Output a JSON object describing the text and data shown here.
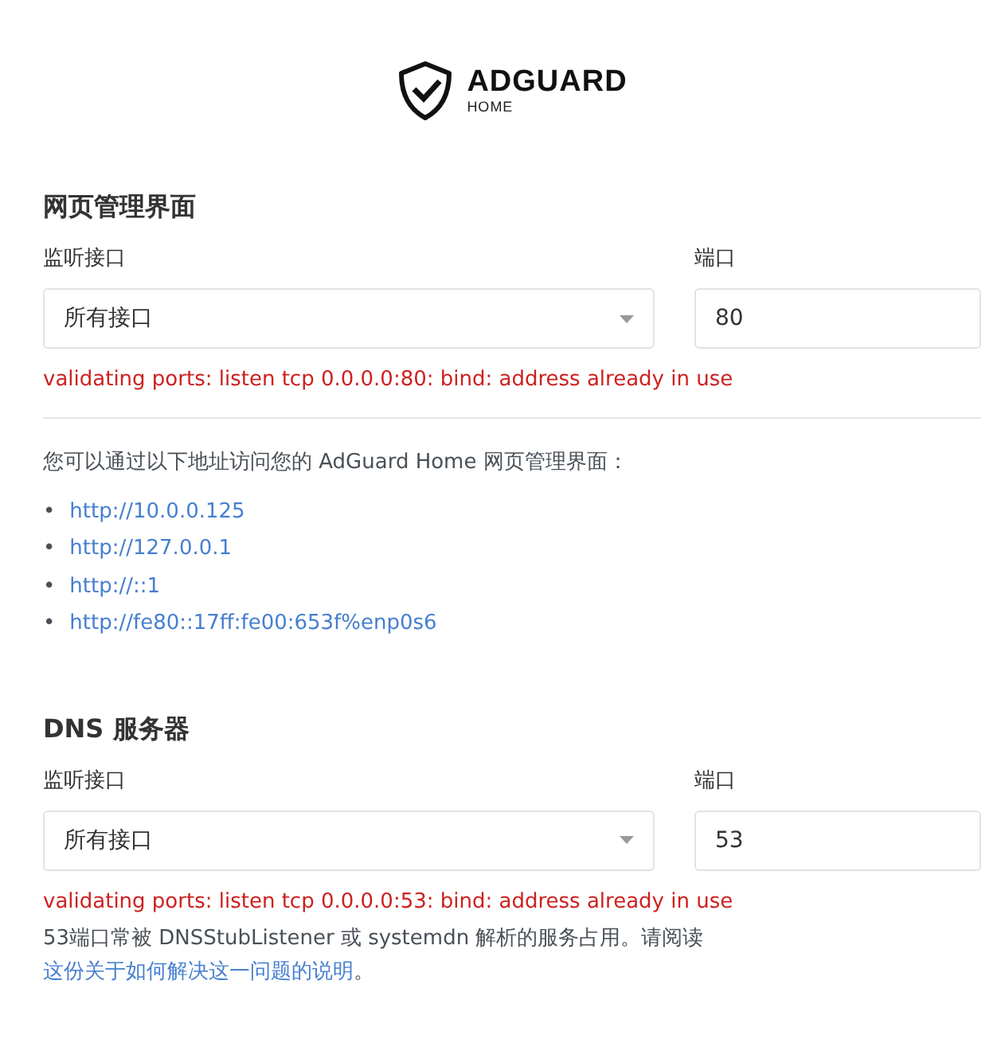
{
  "logo": {
    "title": "ADGUARD",
    "subtitle": "HOME"
  },
  "sections": [
    {
      "title": "网页管理界面",
      "interface_label": "监听接口",
      "interface_value": "所有接口",
      "port_label": "端口",
      "port_value": "80",
      "error": "validating ports: listen tcp 0.0.0.0:80: bind: address already in use",
      "addresses_intro": "您可以通过以下地址访问您的 AdGuard Home 网页管理界面：",
      "addresses": [
        {
          "bullet": "•",
          "url": "http://10.0.0.125"
        },
        {
          "bullet": "•",
          "url": "http://127.0.0.1"
        },
        {
          "bullet": "•",
          "url": "http://::1"
        },
        {
          "bullet": "•",
          "url": "http://fe80::17ff:fe00:653f%enp0s6"
        }
      ]
    },
    {
      "title": "DNS 服务器",
      "interface_label": "监听接口",
      "interface_value": "所有接口",
      "port_label": "端口",
      "port_value": "53",
      "error": "validating ports: listen tcp 0.0.0.0:53: bind: address already in use",
      "note": "53端口常被 DNSStubListener 或 systemdn 解析的服务占用。请阅读",
      "note_link": "这份关于如何解决这一问题的说明",
      "note_end": "。"
    }
  ]
}
